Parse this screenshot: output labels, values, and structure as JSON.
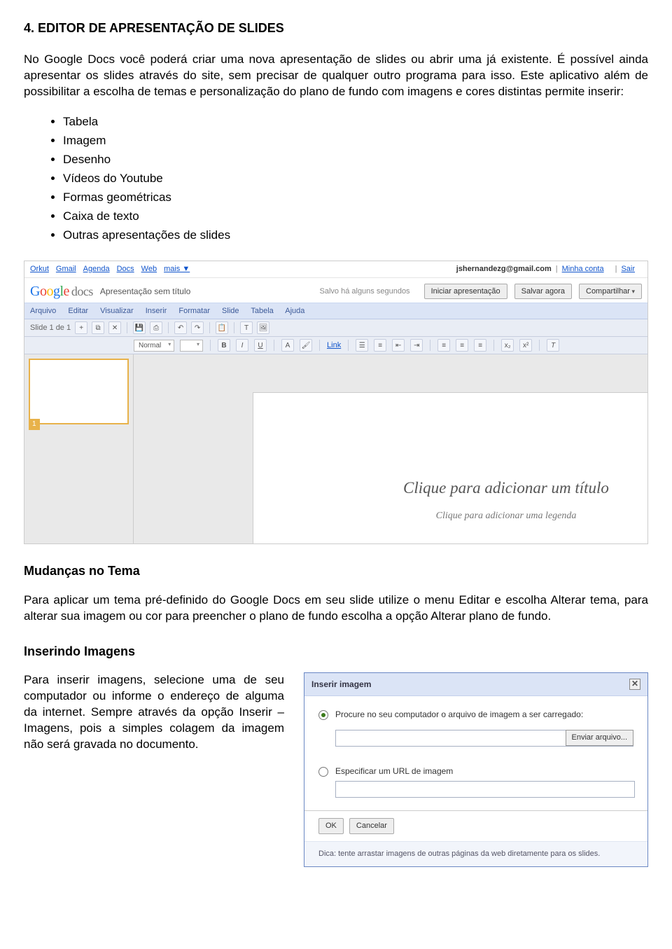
{
  "doc": {
    "heading": "4. EDITOR DE APRESENTAÇÃO DE SLIDES",
    "intro": "No Google Docs você poderá criar uma nova apresentação de slides ou abrir uma já existente. É possível ainda apresentar os slides através do site, sem precisar de qualquer outro programa para isso. Este aplicativo além de possibilitar a escolha de temas e personalização do plano de fundo com imagens e cores distintas permite inserir:",
    "bullets": [
      "Tabela",
      "Imagem",
      "Desenho",
      "Vídeos do Youtube",
      "Formas geométricas",
      "Caixa de texto",
      "Outras apresentações de slides"
    ],
    "h2_mudancas": "Mudanças no Tema",
    "mudancas_text": "Para aplicar um tema pré-definido do Google Docs em seu slide utilize o menu Editar e escolha Alterar tema, para alterar sua imagem ou cor para preencher o plano de fundo escolha a opção Alterar plano de fundo.",
    "h2_inserindo": "Inserindo Imagens",
    "inserindo_text": "Para inserir imagens, selecione uma de seu computador ou informe o endereço de alguma da internet. Sempre através da opção Inserir – Imagens, pois a simples colagem da imagem não será gravada no documento."
  },
  "gdocs": {
    "toplinks": [
      "Orkut",
      "Gmail",
      "Agenda",
      "Docs",
      "Web",
      "mais ▼"
    ],
    "account": "jshernandezg@gmail.com",
    "acc_links": [
      "Minha conta",
      "Sair"
    ],
    "brand_docs": "docs",
    "title": "Apresentação sem título",
    "status": "Salvo há alguns segundos",
    "btn_iniciar": "Iniciar apresentação",
    "btn_salvar": "Salvar agora",
    "btn_compart": "Compartilhar",
    "menus": [
      "Arquivo",
      "Editar",
      "Visualizar",
      "Inserir",
      "Formatar",
      "Slide",
      "Tabela",
      "Ajuda"
    ],
    "slide_of": "Slide 1 de 1",
    "font_sel": "Normal",
    "link_label": "Link",
    "thumb_num": "1",
    "placeholder_title": "Clique para adicionar um título",
    "placeholder_sub": "Clique para adicionar uma legenda"
  },
  "dialog": {
    "title": "Inserir imagem",
    "opt1": "Procure no seu computador o arquivo de imagem a ser carregado:",
    "btn_enviar": "Enviar arquivo...",
    "opt2": "Especificar um URL de imagem",
    "btn_ok": "OK",
    "btn_cancel": "Cancelar",
    "hint": "Dica: tente arrastar imagens de outras páginas da web diretamente para os slides."
  }
}
